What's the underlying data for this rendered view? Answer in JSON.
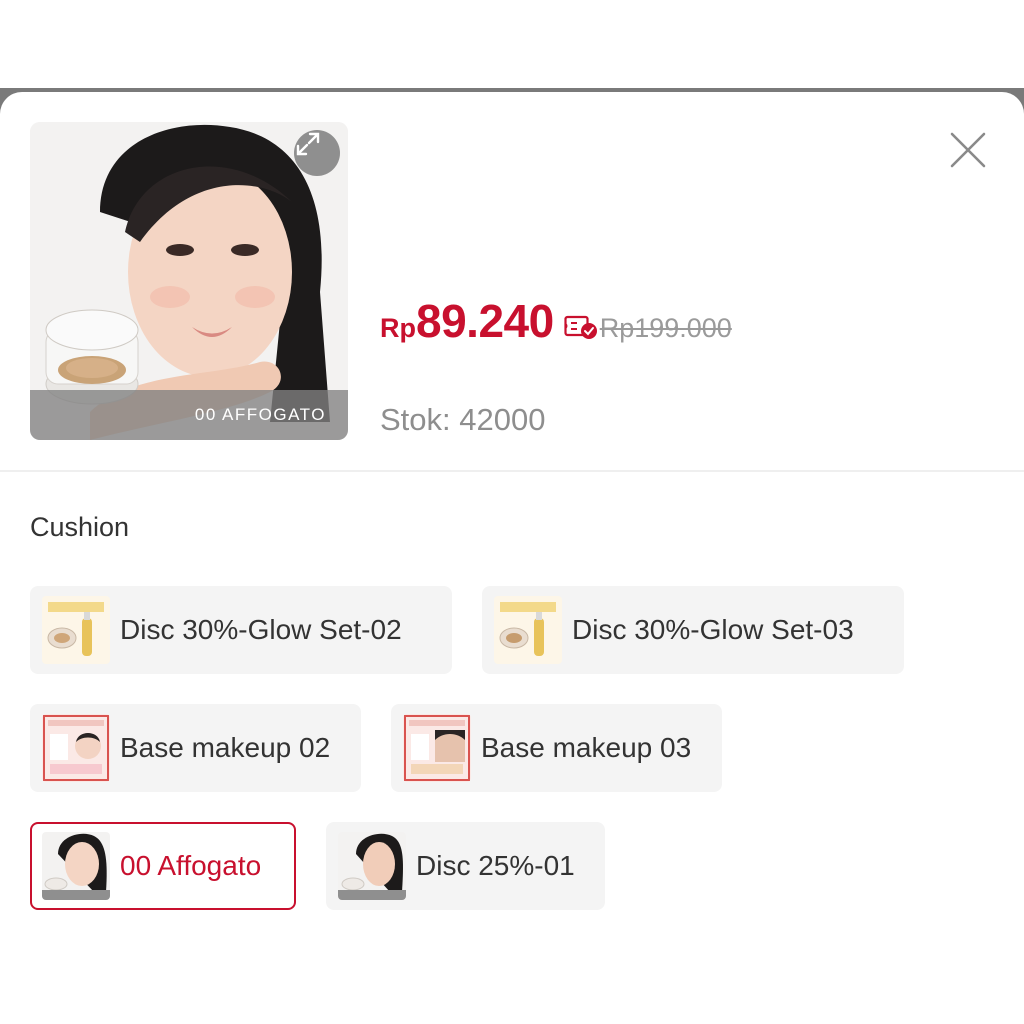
{
  "product": {
    "image_caption": "00 AFFOGATO",
    "price_currency": "Rp",
    "price_value": "89.240",
    "price_original": "Rp199.000",
    "stock_text": "Stok: 42000"
  },
  "variant_group": {
    "title": "Cushion",
    "options": [
      {
        "label": "Disc 30%-Glow Set-02",
        "selected": false
      },
      {
        "label": "Disc 30%-Glow Set-03",
        "selected": false
      },
      {
        "label": "Base makeup 02",
        "selected": false
      },
      {
        "label": "Base makeup 03",
        "selected": false
      },
      {
        "label": "00 Affogato",
        "selected": true
      },
      {
        "label": "Disc 25%-01",
        "selected": false
      }
    ]
  },
  "icons": {
    "expand": "expand-arrows-icon",
    "close": "close-icon",
    "voucher": "voucher-check-icon"
  },
  "colors": {
    "accent": "#c8102e",
    "chip_bg": "#f4f4f4",
    "muted": "#9a9a9a"
  }
}
